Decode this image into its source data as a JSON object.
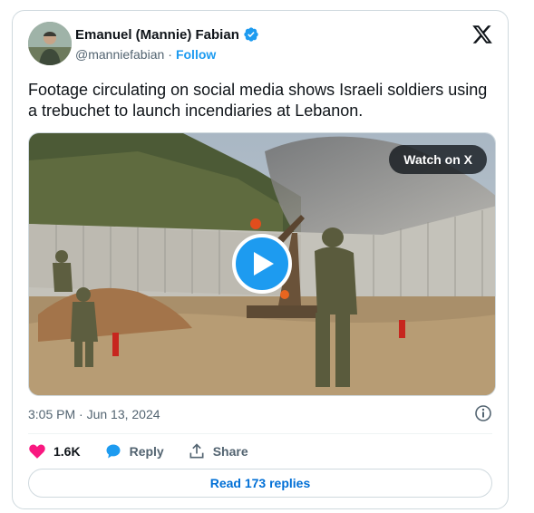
{
  "author": {
    "name": "Emanuel (Mannie) Fabian",
    "handle": "@manniefabian",
    "separator": "·",
    "follow_label": "Follow"
  },
  "tweet": {
    "text": "Footage circulating on social media shows Israeli soldiers using a trebuchet to launch incendiaries at Lebanon.",
    "timestamp": "3:05 PM · Jun 13, 2024"
  },
  "media": {
    "watch_label": "Watch on X"
  },
  "actions": {
    "like_count": "1.6K",
    "reply_label": "Reply",
    "share_label": "Share"
  },
  "read_replies_label": "Read 173 replies",
  "colors": {
    "accent": "#1d9bf0",
    "like": "#f91880",
    "reply_link": "#006fd6",
    "muted_text": "#536471"
  }
}
